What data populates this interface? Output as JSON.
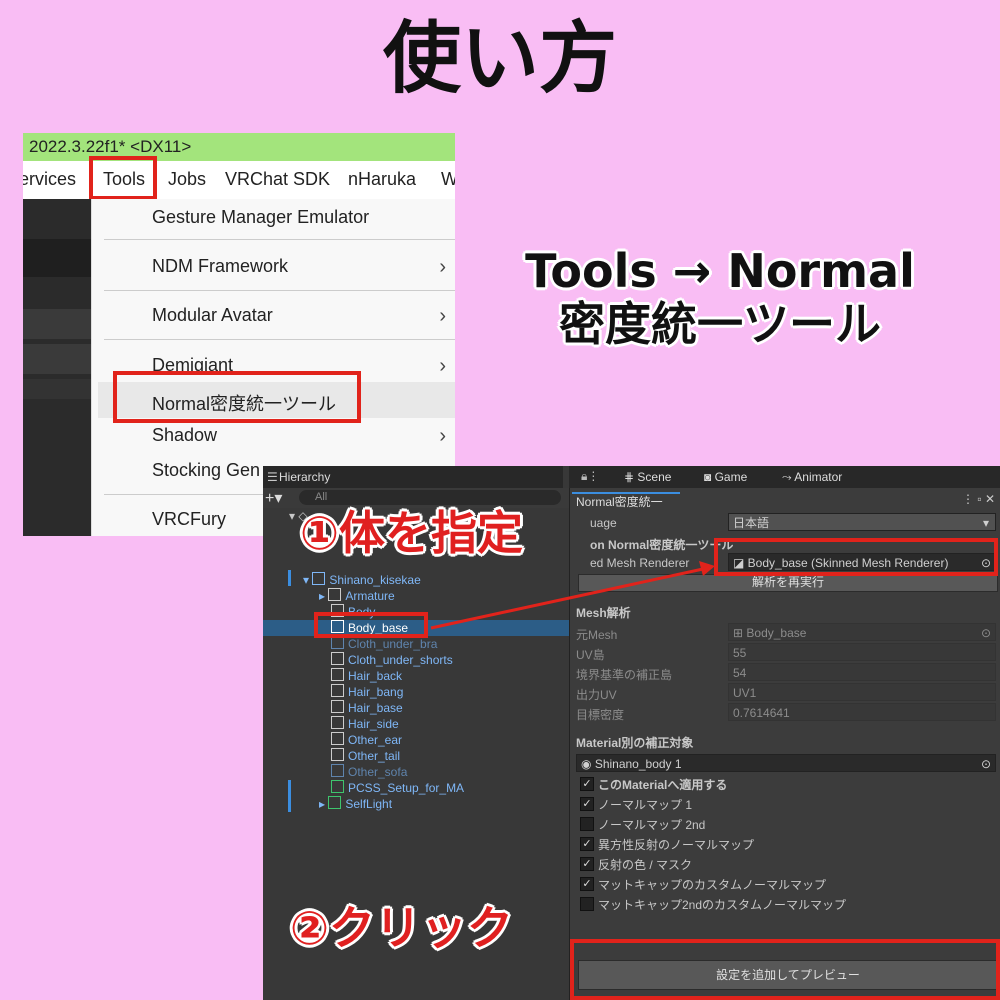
{
  "title": "使い方",
  "caption": {
    "line1": "Tools → Normal",
    "line2": "密度統一ツール"
  },
  "menu_screenshot": {
    "window_title": "2022.3.22f1* <DX11>",
    "menubar": [
      "ervices",
      "Tools",
      "Jobs",
      "VRChat SDK",
      "nHaruka",
      "W"
    ],
    "items": [
      {
        "label": "Gesture Manager Emulator",
        "submenu": false
      },
      {
        "label": "NDM Framework",
        "submenu": true
      },
      {
        "label": "Modular Avatar",
        "submenu": true
      },
      {
        "label": "Demigiant",
        "submenu": true
      },
      {
        "label": "Normal密度統一ツール",
        "submenu": false
      },
      {
        "label": "Shadow",
        "submenu": true
      },
      {
        "label": "Stocking Gen",
        "submenu": false
      },
      {
        "label": "VRCFury",
        "submenu": false
      }
    ],
    "submenu_arrow": "›"
  },
  "steps": {
    "step1": "①体を指定",
    "step2": "②クリック"
  },
  "hierarchy": {
    "tab": "Hierarchy",
    "search_placeholder": "All",
    "root": "Shinano_kisekae",
    "items": [
      {
        "label": "Armature",
        "style": "blue"
      },
      {
        "label": "Body",
        "style": "blue"
      },
      {
        "label": "Body_base",
        "style": "selected"
      },
      {
        "label": "Cloth_under_bra",
        "style": "dim"
      },
      {
        "label": "Cloth_under_shorts",
        "style": "blue"
      },
      {
        "label": "Hair_back",
        "style": "blue"
      },
      {
        "label": "Hair_bang",
        "style": "blue"
      },
      {
        "label": "Hair_base",
        "style": "blue"
      },
      {
        "label": "Hair_side",
        "style": "blue"
      },
      {
        "label": "Other_ear",
        "style": "blue"
      },
      {
        "label": "Other_tail",
        "style": "blue"
      },
      {
        "label": "Other_sofa",
        "style": "dim"
      },
      {
        "label": "PCSS_Setup_for_MA",
        "style": "blue"
      },
      {
        "label": "SelfLight",
        "style": "blue"
      }
    ]
  },
  "editor_tabs": [
    "Scene",
    "Game",
    "Animator"
  ],
  "inspector": {
    "window_tab": "Normal密度統一",
    "language_label": "uage",
    "language_value": "日本語",
    "header": "on Normal密度統一ツール",
    "renderer_label": "ed Mesh Renderer",
    "renderer_value": "Body_base (Skinned Mesh Renderer)",
    "reanalyze_button": "解析を再実行",
    "mesh_section": "Mesh解析",
    "mesh_rows": [
      {
        "label": "元Mesh",
        "value": "Body_base"
      },
      {
        "label": "UV島",
        "value": "55"
      },
      {
        "label": "境界基準の補正島",
        "value": "54"
      },
      {
        "label": "出力UV",
        "value": "UV1"
      },
      {
        "label": "目標密度",
        "value": "0.7614641"
      }
    ],
    "material_section": "Material別の補正対象",
    "material_value": "Shinano_body 1",
    "toggles": [
      {
        "label": "このMaterialへ適用する",
        "checked": true,
        "bold": true
      },
      {
        "label": "ノーマルマップ 1",
        "checked": true,
        "bold": false
      },
      {
        "label": "ノーマルマップ 2nd",
        "checked": false,
        "bold": false
      },
      {
        "label": "異方性反射のノーマルマップ",
        "checked": true,
        "bold": false
      },
      {
        "label": "反射の色 / マスク",
        "checked": true,
        "bold": false
      },
      {
        "label": "マットキャップのカスタムノーマルマップ",
        "checked": true,
        "bold": false
      },
      {
        "label": "マットキャップ2ndのカスタムノーマルマップ",
        "checked": false,
        "bold": false
      }
    ],
    "preview_button": "設定を追加してプレビュー",
    "check_mark": "✓"
  },
  "colors": {
    "annotation_red": "#e1231b",
    "background_pink": "#f9bdf4",
    "titlebar_green": "#a3e47c",
    "selection_blue": "#2c5d87"
  }
}
